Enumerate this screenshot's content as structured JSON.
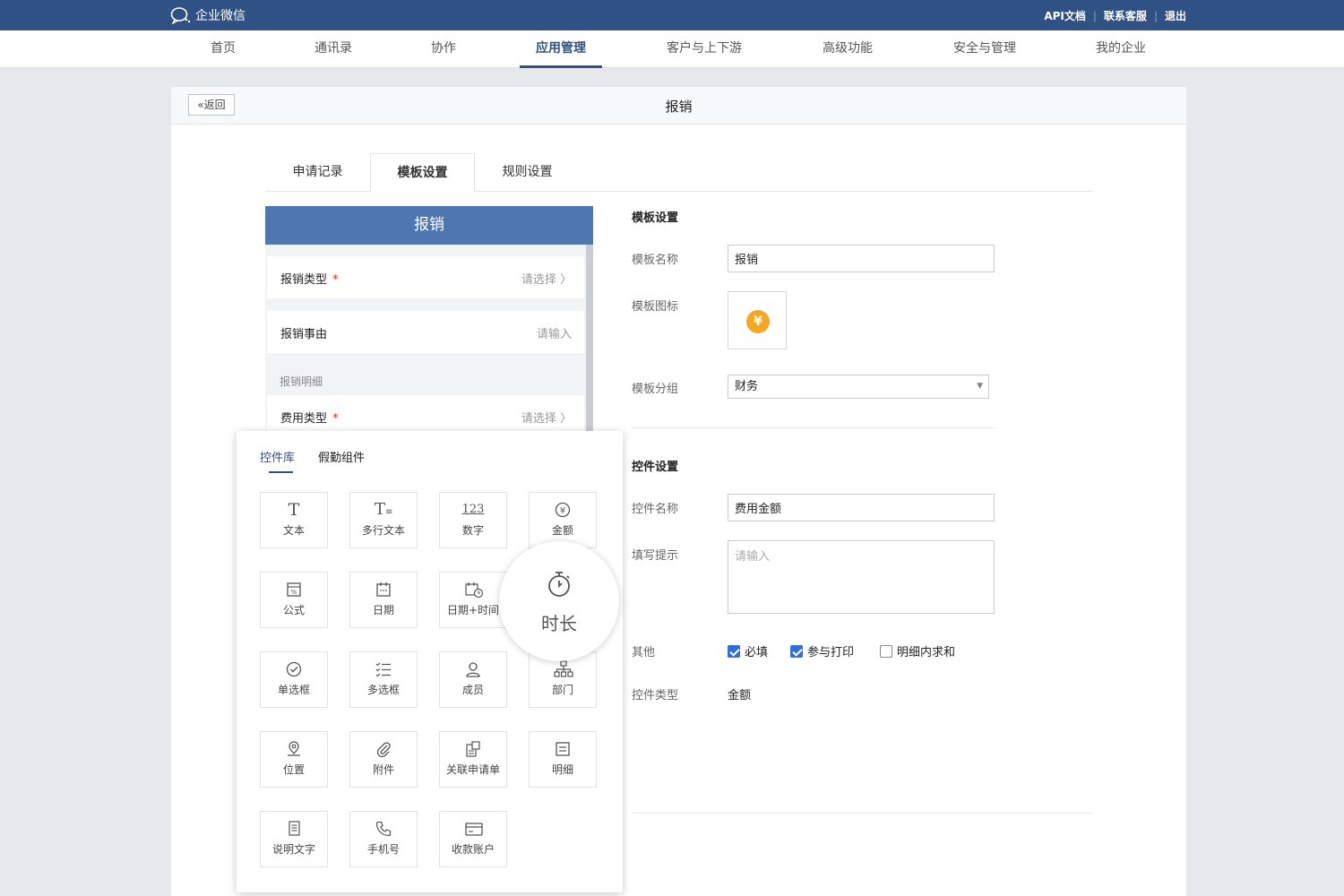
{
  "topbar": {
    "logo_text": "企业微信",
    "links": [
      "API文档",
      "联系客服",
      "退出"
    ]
  },
  "nav": {
    "items": [
      "首页",
      "通讯录",
      "协作",
      "应用管理",
      "客户与上下游",
      "高级功能",
      "安全与管理",
      "我的企业"
    ],
    "active": "应用管理"
  },
  "panel": {
    "back_label": "«返回",
    "title": "报销"
  },
  "tabs": [
    "申请记录",
    "模板设置",
    "规则设置"
  ],
  "preview": {
    "header": "报销",
    "rows": [
      {
        "label": "报销类型",
        "required": "*",
        "value": "请选择 〉"
      },
      {
        "label": "报销事由",
        "required": "",
        "value": "请输入"
      },
      {
        "label": "费用类型",
        "required": "*",
        "value": "请选择 〉"
      }
    ],
    "section": "报销明细"
  },
  "popup": {
    "tabs": [
      "控件库",
      "假勤组件"
    ],
    "widgets": [
      {
        "icon": "text-icon",
        "label": "文本"
      },
      {
        "icon": "multiline-text-icon",
        "label": "多行文本"
      },
      {
        "icon": "number-icon",
        "label": "数字"
      },
      {
        "icon": "amount-icon",
        "label": "金额"
      },
      {
        "icon": "formula-icon",
        "label": "公式"
      },
      {
        "icon": "date-icon",
        "label": "日期"
      },
      {
        "icon": "datetime-icon",
        "label": "日期+时间"
      },
      {
        "icon": "duration-icon",
        "label": "时长"
      },
      {
        "icon": "radio-icon",
        "label": "单选框"
      },
      {
        "icon": "checkbox-icon",
        "label": "多选框"
      },
      {
        "icon": "member-icon",
        "label": "成员"
      },
      {
        "icon": "department-icon",
        "label": "部门"
      },
      {
        "icon": "location-icon",
        "label": "位置"
      },
      {
        "icon": "attachment-icon",
        "label": "附件"
      },
      {
        "icon": "related-request-icon",
        "label": "关联申请单"
      },
      {
        "icon": "detail-icon",
        "label": "明细"
      },
      {
        "icon": "description-icon",
        "label": "说明文字"
      },
      {
        "icon": "phone-icon",
        "label": "手机号"
      },
      {
        "icon": "account-icon",
        "label": "收款账户"
      }
    ]
  },
  "template_settings": {
    "title": "模板设置",
    "name_label": "模板名称",
    "name_value": "报销",
    "icon_label": "模板图标",
    "icon_glyph": "¥",
    "group_label": "模板分组",
    "group_value": "财务"
  },
  "control_settings": {
    "title": "控件设置",
    "name_label": "控件名称",
    "name_value": "费用金额",
    "hint_label": "填写提示",
    "hint_placeholder": "请输入",
    "other_label": "其他",
    "options": [
      {
        "label": "必填",
        "checked": true
      },
      {
        "label": "参与打印",
        "checked": true
      },
      {
        "label": "明细内求和",
        "checked": false
      }
    ],
    "type_label": "控件类型",
    "type_value": "金额"
  },
  "colors": {
    "brand": "#2f5183",
    "preview_header": "#4f76b0",
    "checkbox": "#2f6fd6",
    "icon_accent": "#f5a623"
  }
}
